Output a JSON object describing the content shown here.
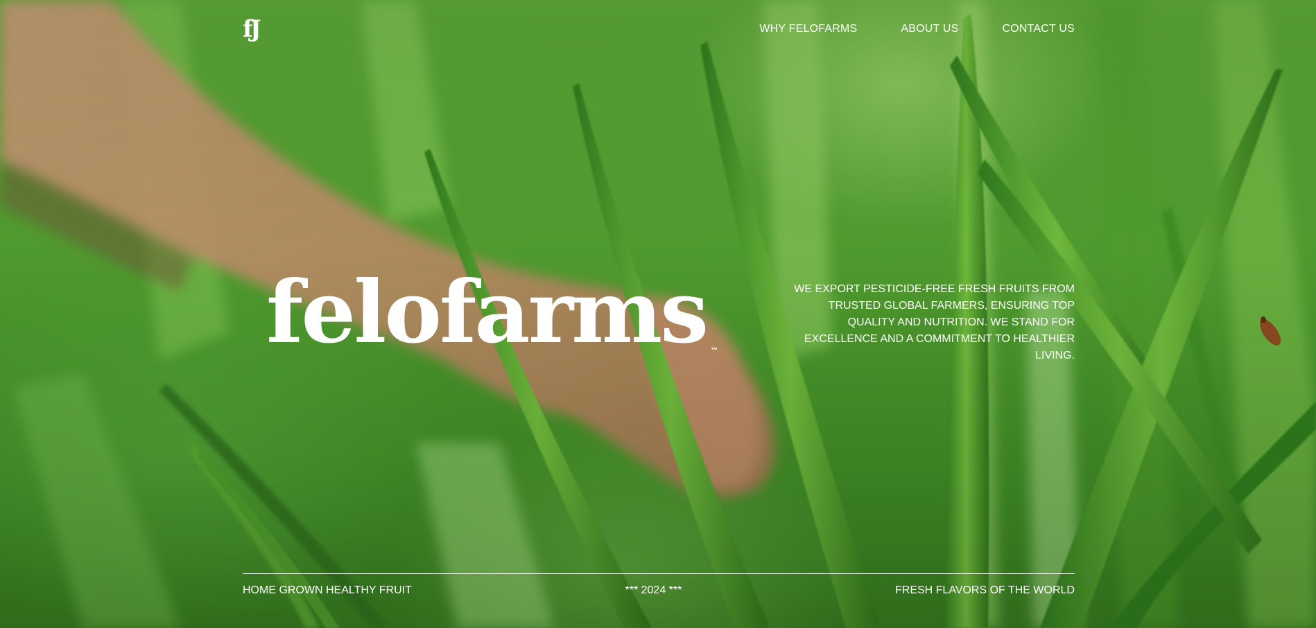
{
  "header": {
    "logo_text": "fJ",
    "nav": [
      {
        "label": "WHY FELOFARMS"
      },
      {
        "label": "ABOUT US"
      },
      {
        "label": "CONTACT US"
      }
    ]
  },
  "hero": {
    "brand": "felofarms",
    "trademark": "™",
    "tagline": "WE EXPORT PESTICIDE-FREE FRESH FRUITS FROM TRUSTED GLOBAL FARMERS, ENSURING TOP QUALITY AND NUTRITION. WE STAND FOR EXCELLENCE AND A COMMITMENT TO HEALTHIER LIVING."
  },
  "footer": {
    "left": "HOME GROWN HEALTHY FRUIT",
    "center": "*** 2024 ***",
    "right": "FRESH FLAVORS OF THE WORLD"
  },
  "colors": {
    "text": "#ffffff",
    "grass_light": "#8cc75a",
    "grass_dark": "#2f6f1c",
    "skin": "#b98a66"
  },
  "background": {
    "description_icon": "grass-and-hand-photo"
  }
}
